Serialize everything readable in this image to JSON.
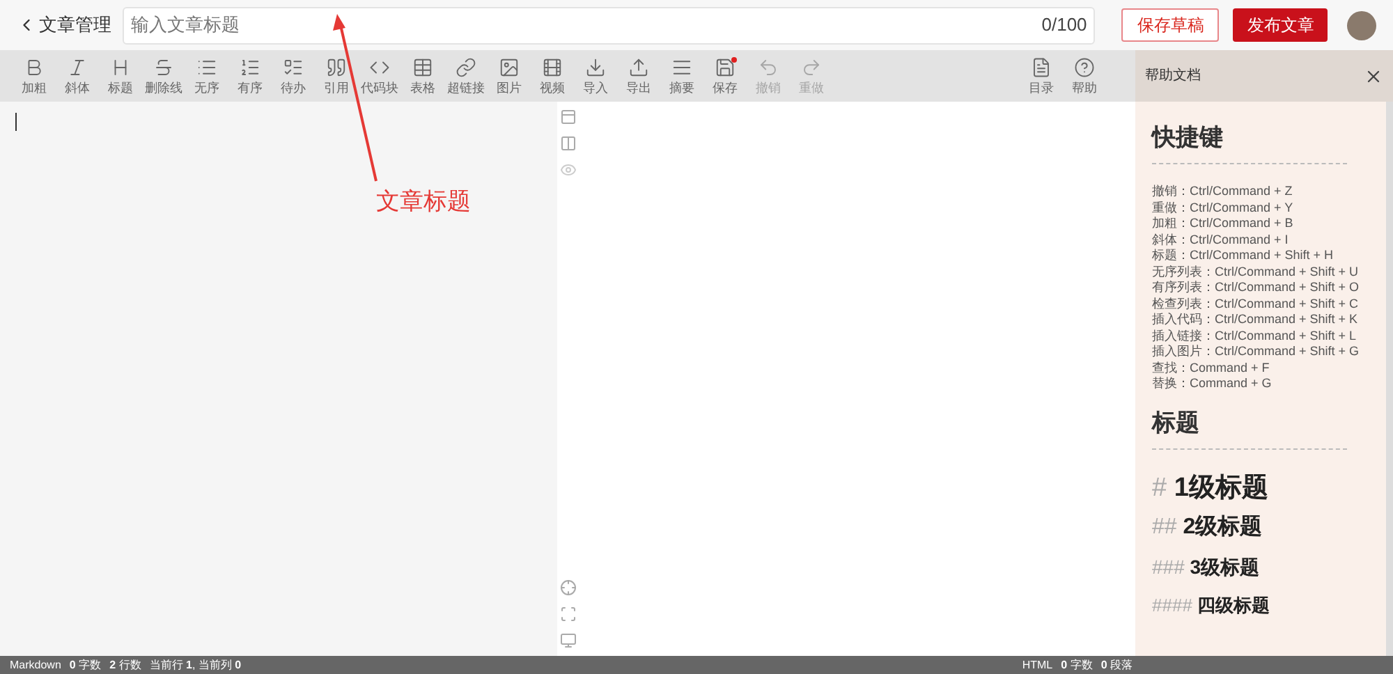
{
  "header": {
    "back": "文章管理",
    "title_placeholder": "输入文章标题",
    "counter": "0/100",
    "draft_button": "保存草稿",
    "publish_button": "发布文章"
  },
  "toolbar": {
    "items": [
      {
        "label": "加粗",
        "disabled": false,
        "dot": false
      },
      {
        "label": "斜体",
        "disabled": false,
        "dot": false
      },
      {
        "label": "标题",
        "disabled": false,
        "dot": false
      },
      {
        "label": "删除线",
        "disabled": false,
        "dot": false
      },
      {
        "label": "无序",
        "disabled": false,
        "dot": false
      },
      {
        "label": "有序",
        "disabled": false,
        "dot": false
      },
      {
        "label": "待办",
        "disabled": false,
        "dot": false
      },
      {
        "label": "引用",
        "disabled": false,
        "dot": false
      },
      {
        "label": "代码块",
        "disabled": false,
        "dot": false
      },
      {
        "label": "表格",
        "disabled": false,
        "dot": false
      },
      {
        "label": "超链接",
        "disabled": false,
        "dot": false
      },
      {
        "label": "图片",
        "disabled": false,
        "dot": false
      },
      {
        "label": "视频",
        "disabled": false,
        "dot": false
      },
      {
        "label": "导入",
        "disabled": false,
        "dot": false
      },
      {
        "label": "导出",
        "disabled": false,
        "dot": false
      },
      {
        "label": "摘要",
        "disabled": false,
        "dot": false
      },
      {
        "label": "保存",
        "disabled": false,
        "dot": true
      },
      {
        "label": "撤销",
        "disabled": true,
        "dot": false
      },
      {
        "label": "重做",
        "disabled": true,
        "dot": false
      }
    ],
    "right_items": [
      {
        "label": "目录"
      },
      {
        "label": "帮助"
      }
    ]
  },
  "help": {
    "title": "帮助文档",
    "sections": [
      {
        "heading": "快捷键",
        "lines": [
          "撤销：Ctrl/Command + Z",
          "重做：Ctrl/Command + Y",
          "加粗：Ctrl/Command + B",
          "斜体：Ctrl/Command + I",
          "标题：Ctrl/Command + Shift + H",
          "无序列表：Ctrl/Command + Shift + U",
          "有序列表：Ctrl/Command + Shift + O",
          "检查列表：Ctrl/Command + Shift + C",
          "插入代码：Ctrl/Command + Shift + K",
          "插入链接：Ctrl/Command + Shift + L",
          "插入图片：Ctrl/Command + Shift + G",
          "查找：Command + F",
          "替换：Command + G"
        ]
      },
      {
        "heading": "标题",
        "examples": [
          {
            "mark": "#",
            "text": "1级标题"
          },
          {
            "mark": "##",
            "text": "2级标题"
          },
          {
            "mark": "###",
            "text": "3级标题"
          },
          {
            "mark": "####",
            "text": "四级标题"
          }
        ]
      }
    ]
  },
  "annotation": {
    "label": "文章标题"
  },
  "status_bar": {
    "left": [
      "Markdown",
      "**0** 字数",
      "**2** 行数",
      "当前行 **1**, 当前列 **0**"
    ],
    "right": [
      "HTML",
      "**0** 字数",
      "**0** 段落"
    ]
  }
}
